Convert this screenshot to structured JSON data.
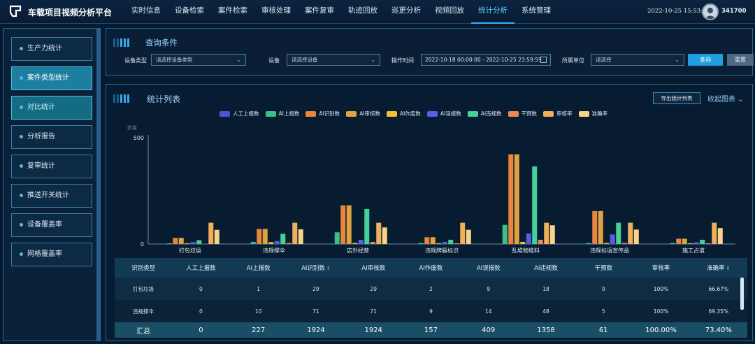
{
  "app": {
    "title": "车载项目视频分析平台",
    "datetime": "2022-10-25 15:53:33",
    "user": "341700"
  },
  "nav": [
    "实时信息",
    "设备检索",
    "案件检索",
    "审核处理",
    "案件复审",
    "轨迹回放",
    "巡更分析",
    "视频回放",
    "统计分析",
    "系统管理"
  ],
  "nav_active": 8,
  "sidebar": {
    "items": [
      "生产力统计",
      "案件类型统计",
      "对比统计",
      "分析报告",
      "复审统计",
      "推送开关统计",
      "设备覆盖率",
      "网格覆盖率"
    ]
  },
  "query": {
    "title": "查询条件",
    "device_type_label": "设备类型",
    "device_type_placeholder": "请选择设备类型",
    "device_label": "设备",
    "device_placeholder": "请选择设备",
    "time_label": "操作时间",
    "time_range": "2022-10-18 00:00:00 - 2022-10-25 23:59:59",
    "unit_label": "所属单位",
    "unit_placeholder": "请选择",
    "search_button": "查询",
    "reset_button": "重置"
  },
  "stats": {
    "title": "统计列表",
    "export_button": "导出统计列表",
    "collapse_label": "收起图表 ⌄"
  },
  "colors": {
    "series": [
      "#4a55d8",
      "#3fbf83",
      "#e8853f",
      "#e0a341",
      "#f1c232",
      "#5361e4",
      "#45d19a",
      "#ed8a52",
      "#eeb159",
      "#f8d38a"
    ]
  },
  "chart_data": {
    "type": "bar",
    "ylabel": "数量",
    "ylim": [
      0,
      500
    ],
    "yticks": [
      0,
      500
    ],
    "categories": [
      "打包垃圾",
      "违规撑伞",
      "店外经营",
      "违规牌匾标识",
      "乱堆物堆料",
      "违规标语宣传品",
      "施工占道"
    ],
    "series": [
      {
        "name": "人工上报数",
        "values": [
          0,
          0,
          0,
          0,
          0,
          0,
          0
        ]
      },
      {
        "name": "AI上报数",
        "values": [
          1,
          10,
          55,
          5,
          90,
          5,
          5
        ]
      },
      {
        "name": "AI识别数",
        "values": [
          29,
          71,
          182,
          32,
          422,
          155,
          25
        ]
      },
      {
        "name": "AI审核数",
        "values": [
          29,
          71,
          182,
          32,
          422,
          155,
          25
        ]
      },
      {
        "name": "AI作废数",
        "values": [
          2,
          9,
          5,
          3,
          10,
          5,
          3
        ]
      },
      {
        "name": "AI误报数",
        "values": [
          9,
          14,
          20,
          10,
          50,
          45,
          8
        ]
      },
      {
        "name": "AI违规数",
        "values": [
          18,
          48,
          165,
          20,
          365,
          100,
          20
        ]
      },
      {
        "name": "干预数",
        "values": [
          0,
          5,
          10,
          3,
          20,
          5,
          3
        ]
      },
      {
        "name": "审核率",
        "values": [
          100,
          100,
          100,
          100,
          100,
          100,
          100
        ]
      },
      {
        "name": "准确率",
        "values": [
          66.67,
          69.35,
          78,
          67,
          88,
          68,
          75
        ]
      }
    ]
  },
  "table": {
    "headers": [
      "识别类型",
      "人工上报数",
      "AI上报数",
      "AI识别数",
      "AI审核数",
      "AI作废数",
      "AI误报数",
      "AI违规数",
      "干预数",
      "审核率",
      "准确率"
    ],
    "sortable": [
      false,
      false,
      false,
      true,
      false,
      false,
      false,
      false,
      false,
      false,
      true
    ],
    "rows": [
      [
        "打包垃圾",
        "0",
        "1",
        "29",
        "29",
        "2",
        "9",
        "18",
        "0",
        "100%",
        "66.67%"
      ],
      [
        "违规撑伞",
        "0",
        "10",
        "71",
        "71",
        "9",
        "14",
        "48",
        "5",
        "100%",
        "69.35%"
      ]
    ],
    "total": [
      "汇总",
      "0",
      "227",
      "1924",
      "1924",
      "157",
      "409",
      "1358",
      "61",
      "100.00%",
      "73.40%"
    ]
  }
}
